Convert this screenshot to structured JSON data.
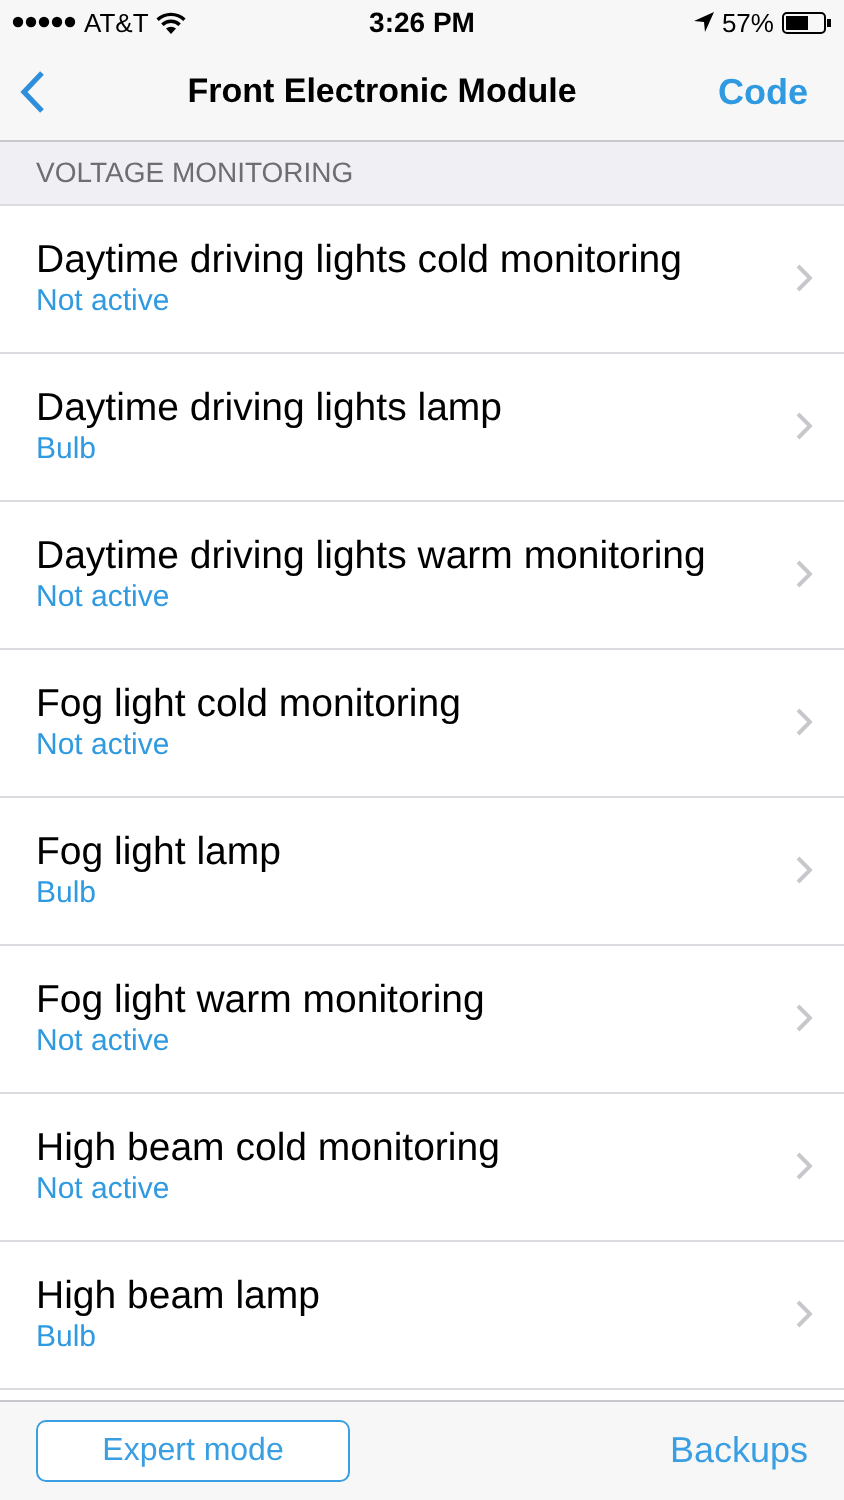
{
  "status_bar": {
    "carrier": "AT&T",
    "time": "3:26 PM",
    "battery": "57%"
  },
  "nav_bar": {
    "title": "Front Electronic Module",
    "action": "Code"
  },
  "section": {
    "header": "VOLTAGE MONITORING",
    "rows": [
      {
        "title": "Daytime driving lights cold monitoring",
        "value": "Not active"
      },
      {
        "title": "Daytime driving lights lamp",
        "value": "Bulb"
      },
      {
        "title": "Daytime driving lights warm monitoring",
        "value": "Not active"
      },
      {
        "title": "Fog light cold monitoring",
        "value": "Not active"
      },
      {
        "title": "Fog light lamp",
        "value": "Bulb"
      },
      {
        "title": "Fog light warm monitoring",
        "value": "Not active"
      },
      {
        "title": "High beam cold monitoring",
        "value": "Not active"
      },
      {
        "title": "High beam lamp",
        "value": "Bulb"
      }
    ]
  },
  "toolbar": {
    "left_button": "Expert mode",
    "right_button": "Backups"
  }
}
